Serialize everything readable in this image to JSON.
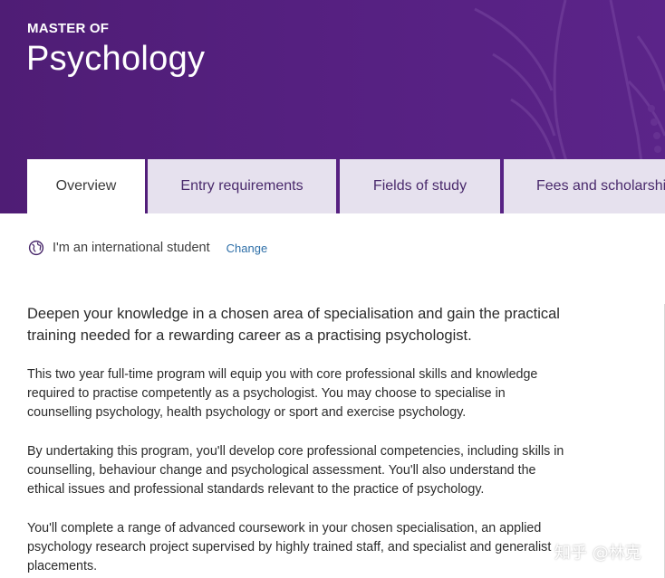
{
  "header": {
    "eyebrow": "MASTER OF",
    "title": "Psychology"
  },
  "tabs": [
    {
      "label": "Overview",
      "active": true
    },
    {
      "label": "Entry requirements",
      "active": false
    },
    {
      "label": "Fields of study",
      "active": false
    },
    {
      "label": "Fees and scholarshi",
      "active": false
    }
  ],
  "student_type": {
    "icon": "globe-icon",
    "label": "I'm an international student",
    "change_label": "Change"
  },
  "content": {
    "lead": "Deepen your knowledge in a chosen area of specialisation and gain the practical training needed for a rewarding career as a practising psychologist.",
    "paragraphs": [
      "This two year full-time program will equip you with core professional skills and knowledge required to practise competently as a psychologist. You may choose to specialise in counselling psychology, health psychology or sport and exercise psychology.",
      "By undertaking this program, you'll develop core professional competencies, including skills in counselling, behaviour change and psychological assessment. You'll also understand the ethical issues and professional standards relevant to the practice of psychology.",
      "You'll complete a range of advanced coursework in your chosen specialisation, an applied psychology research project supervised by highly trained staff, and specialist and generalist placements."
    ]
  },
  "watermark": "知乎 @林克",
  "colors": {
    "hero": "#552080",
    "tab_inactive": "#e6e1ee",
    "link": "#2e6fa8"
  }
}
